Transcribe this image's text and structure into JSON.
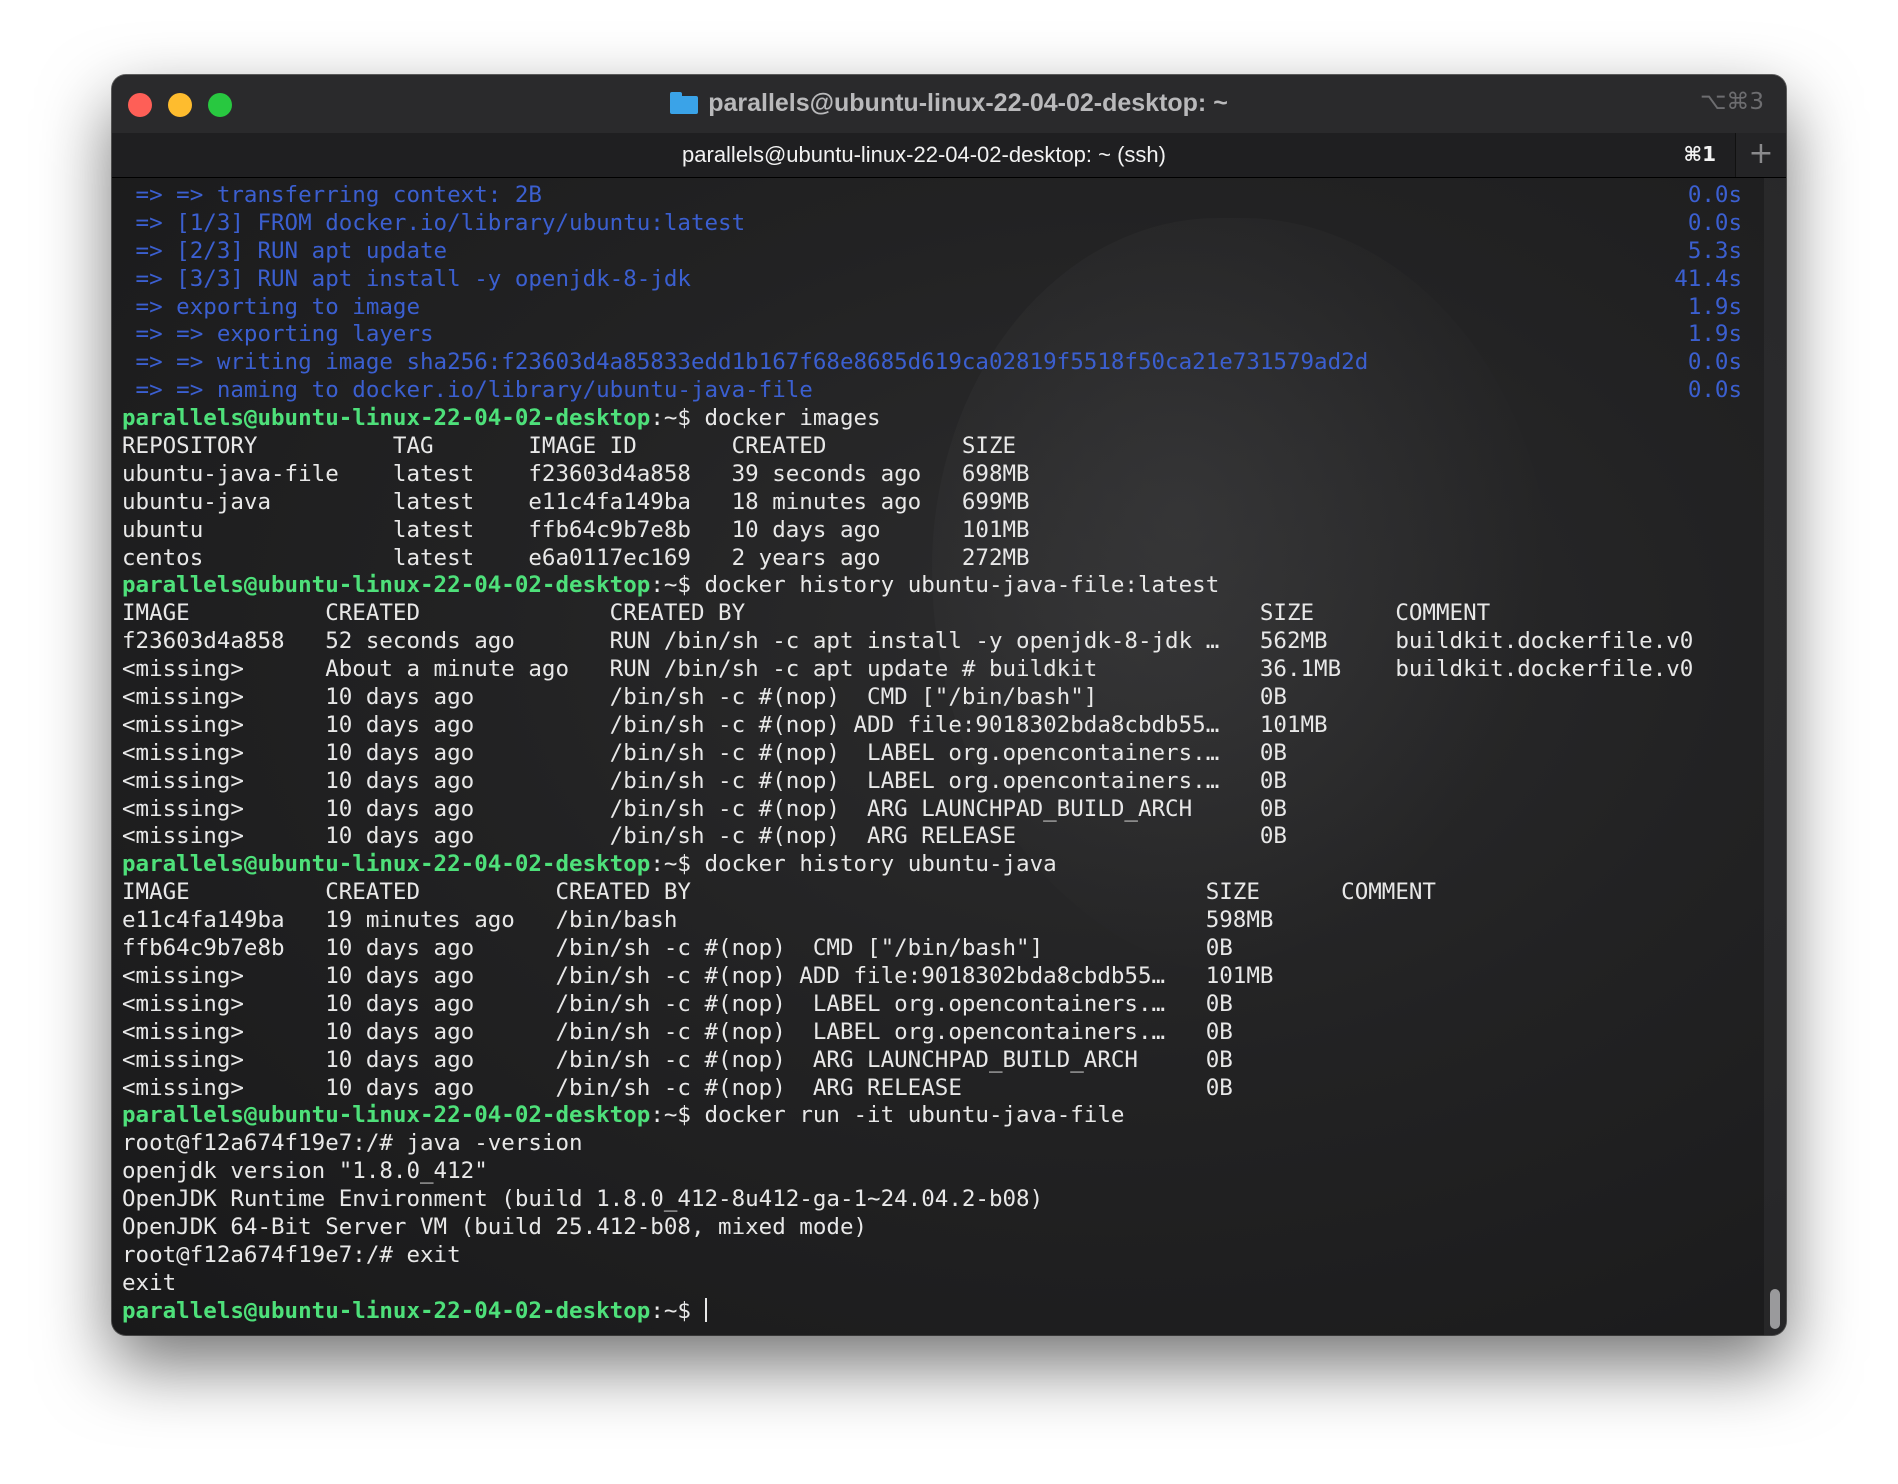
{
  "window": {
    "title": "parallels@ubuntu-linux-22-04-02-desktop: ~",
    "shortcut": "⌥⌘3"
  },
  "tab": {
    "label": "parallels@ubuntu-linux-22-04-02-desktop: ~ (ssh)",
    "shortcut": "⌘1",
    "new_tab": "+"
  },
  "prompt": "parallels@ubuntu-linux-22-04-02-desktop",
  "prompt_suffix": ":~$ ",
  "build_lines": [
    {
      "text": " => => transferring context: 2B",
      "time": "0.0s"
    },
    {
      "text": " => [1/3] FROM docker.io/library/ubuntu:latest",
      "time": "0.0s"
    },
    {
      "text": " => [2/3] RUN apt update",
      "time": "5.3s"
    },
    {
      "text": " => [3/3] RUN apt install -y openjdk-8-jdk",
      "time": "41.4s"
    },
    {
      "text": " => exporting to image",
      "time": "1.9s"
    },
    {
      "text": " => => exporting layers",
      "time": "1.9s"
    },
    {
      "text": " => => writing image sha256:f23603d4a85833edd1b167f68e8685d619ca02819f5518f50ca21e731579ad2d",
      "time": "0.0s"
    },
    {
      "text": " => => naming to docker.io/library/ubuntu-java-file",
      "time": "0.0s"
    }
  ],
  "cmd_images": "docker images",
  "images_table": [
    "REPOSITORY          TAG       IMAGE ID       CREATED          SIZE",
    "ubuntu-java-file    latest    f23603d4a858   39 seconds ago   698MB",
    "ubuntu-java         latest    e11c4fa149ba   18 minutes ago   699MB",
    "ubuntu              latest    ffb64c9b7e8b   10 days ago      101MB",
    "centos              latest    e6a0117ec169   2 years ago      272MB"
  ],
  "cmd_history_file": "docker history ubuntu-java-file:latest",
  "history_file_table": [
    "IMAGE          CREATED              CREATED BY                                      SIZE      COMMENT",
    "f23603d4a858   52 seconds ago       RUN /bin/sh -c apt install -y openjdk-8-jdk …   562MB     buildkit.dockerfile.v0",
    "<missing>      About a minute ago   RUN /bin/sh -c apt update # buildkit            36.1MB    buildkit.dockerfile.v0",
    "<missing>      10 days ago          /bin/sh -c #(nop)  CMD [\"/bin/bash\"]            0B",
    "<missing>      10 days ago          /bin/sh -c #(nop) ADD file:9018302bda8cbdb55…   101MB",
    "<missing>      10 days ago          /bin/sh -c #(nop)  LABEL org.opencontainers.…   0B",
    "<missing>      10 days ago          /bin/sh -c #(nop)  LABEL org.opencontainers.…   0B",
    "<missing>      10 days ago          /bin/sh -c #(nop)  ARG LAUNCHPAD_BUILD_ARCH     0B",
    "<missing>      10 days ago          /bin/sh -c #(nop)  ARG RELEASE                  0B"
  ],
  "cmd_history_java": "docker history ubuntu-java",
  "history_java_table": [
    "IMAGE          CREATED          CREATED BY                                      SIZE      COMMENT",
    "e11c4fa149ba   19 minutes ago   /bin/bash                                       598MB",
    "ffb64c9b7e8b   10 days ago      /bin/sh -c #(nop)  CMD [\"/bin/bash\"]            0B",
    "<missing>      10 days ago      /bin/sh -c #(nop) ADD file:9018302bda8cbdb55…   101MB",
    "<missing>      10 days ago      /bin/sh -c #(nop)  LABEL org.opencontainers.…   0B",
    "<missing>      10 days ago      /bin/sh -c #(nop)  LABEL org.opencontainers.…   0B",
    "<missing>      10 days ago      /bin/sh -c #(nop)  ARG LAUNCHPAD_BUILD_ARCH     0B",
    "<missing>      10 days ago      /bin/sh -c #(nop)  ARG RELEASE                  0B"
  ],
  "cmd_run": "docker run -it ubuntu-java-file",
  "run_output": [
    "root@f12a674f19e7:/# java -version",
    "openjdk version \"1.8.0_412\"",
    "OpenJDK Runtime Environment (build 1.8.0_412-8u412-ga-1~24.04.2-b08)",
    "OpenJDK 64-Bit Server VM (build 25.412-b08, mixed mode)",
    "root@f12a674f19e7:/# exit",
    "exit"
  ],
  "colors": {
    "prompt": "#4ee07a",
    "build_output": "#3b5fd0",
    "text": "#e8e8e8",
    "close": "#fe5f57",
    "minimize": "#febc2e",
    "zoom": "#28c840"
  }
}
